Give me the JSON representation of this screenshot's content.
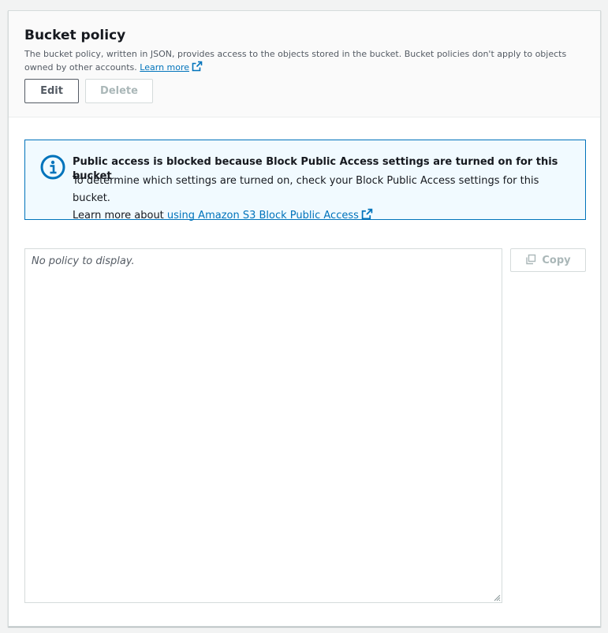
{
  "bucket_policy": {
    "title": "Bucket policy",
    "description": "The bucket policy, written in JSON, provides access to the objects stored in the bucket. Bucket policies don't apply to objects owned by other accounts.",
    "learn_more_label": "Learn more",
    "edit_label": "Edit",
    "delete_label": "Delete"
  },
  "alert": {
    "title": "Public access is blocked because Block Public Access settings are turned on for this bucket",
    "body": "To determine which settings are turned on, check your Block Public Access settings for this bucket.",
    "learn_prefix": "Learn more about",
    "link_label": "using Amazon S3 Block Public Access"
  },
  "policy_viewer": {
    "empty_text": "No policy to display.",
    "copy_label": "Copy"
  },
  "colors": {
    "link": "#0073bb",
    "info": "#0073bb",
    "alert_background": "#f1faff",
    "disabled": "#aab7b8"
  },
  "icons": {
    "info": "info-circle-icon",
    "external_link": "external-link-icon",
    "copy": "copy-icon",
    "resize": "resize-handle-icon"
  }
}
